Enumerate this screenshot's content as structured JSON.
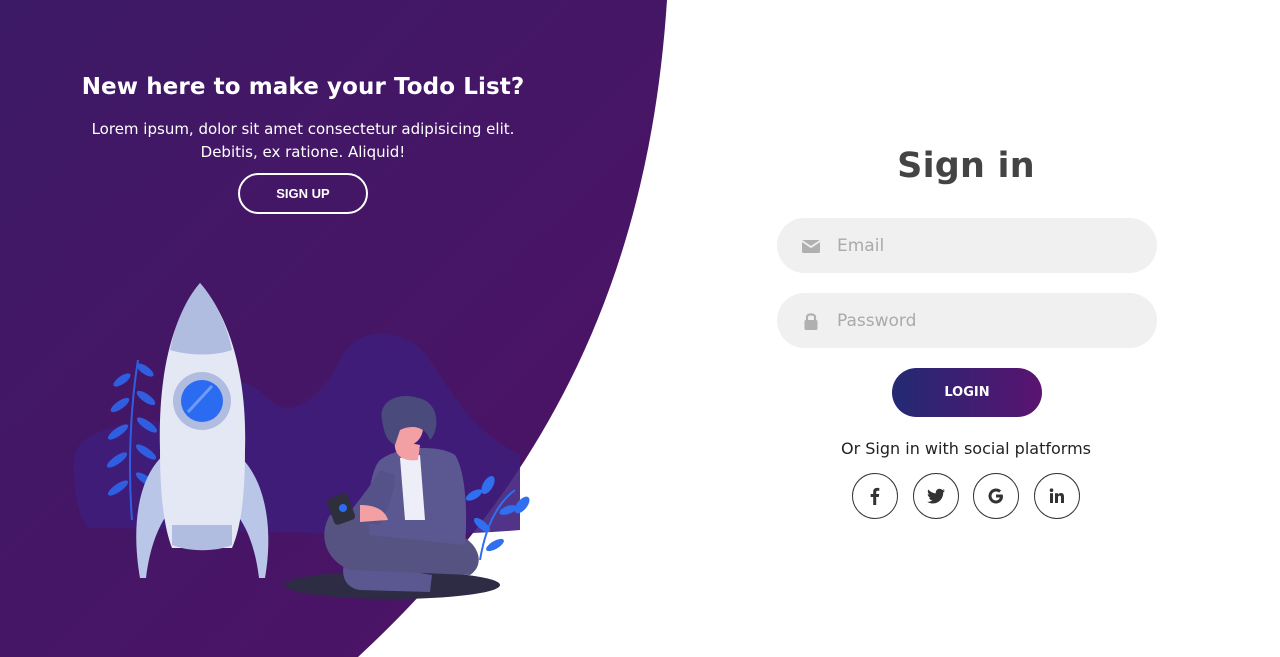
{
  "left_panel": {
    "title": "New here to make your Todo List?",
    "text_line1": "Lorem ipsum, dolor sit amet consectetur adipisicing elit.",
    "text_line2": "Debitis, ex ratione. Aliquid!",
    "signup_label": "SIGN UP"
  },
  "form": {
    "title": "Sign in",
    "email_placeholder": "Email",
    "email_icon": "envelope-icon",
    "password_placeholder": "Password",
    "password_icon": "lock-icon",
    "login_label": "LOGIN",
    "social_text": "Or Sign in with social platforms",
    "social": [
      {
        "name": "facebook-icon"
      },
      {
        "name": "twitter-icon"
      },
      {
        "name": "google-icon"
      },
      {
        "name": "linkedin-icon"
      }
    ]
  },
  "colors": {
    "panel_purple": "#4a1568",
    "login_gradient_start": "#232a73",
    "login_gradient_end": "#5a1370",
    "input_bg": "#f0f0f0",
    "title_gray": "#444444"
  }
}
